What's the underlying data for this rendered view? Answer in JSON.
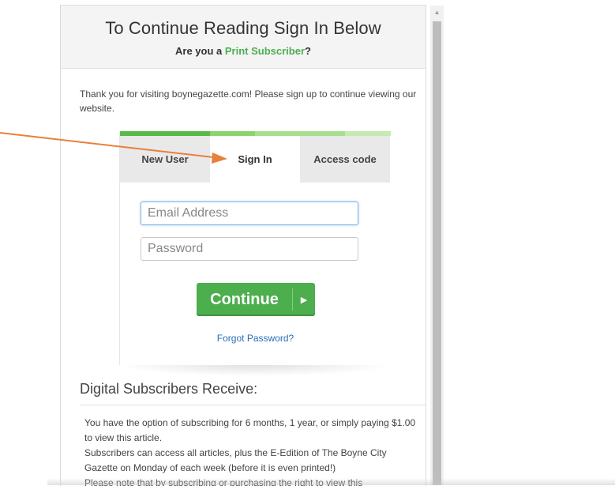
{
  "modal": {
    "title": "To Continue Reading Sign In Below",
    "subtitle_prefix": "Are you a ",
    "subtitle_link": "Print Subscriber",
    "subtitle_suffix": "?",
    "intro": "Thank you for visiting boynegazette.com! Please sign up to continue viewing our website."
  },
  "progress_colors": [
    "#5aba47",
    "#8bd36e",
    "#a8df8f",
    "#c5ebb0"
  ],
  "tabs": [
    {
      "label": "New User"
    },
    {
      "label": "Sign In",
      "active": true
    },
    {
      "label": "Access code"
    }
  ],
  "form": {
    "email_placeholder": "Email Address",
    "password_placeholder": "Password",
    "continue_label": "Continue",
    "forgot_label": "Forgot Password?"
  },
  "benefits": {
    "title": "Digital Subscribers Receive:",
    "lines": [
      "You have the option of subscribing for 6 months, 1 year, or simply paying $1.00 to view this article.",
      "Subscribers can access all articles, plus the E-Edition of The Boyne City Gazette on Monday of each week (before it is even printed!)",
      "Please note that by subscribing or purchasing the right to view this"
    ]
  },
  "colors": {
    "accent_green": "#4cae4c",
    "link_green": "#4caf50",
    "link_blue": "#2a6fb5",
    "annotation_arrow": "#e8803a"
  },
  "icons": {
    "scroll_up": "triangle-up-icon",
    "continue_arrow": "triangle-right-icon",
    "annotation": "arrow-icon"
  }
}
